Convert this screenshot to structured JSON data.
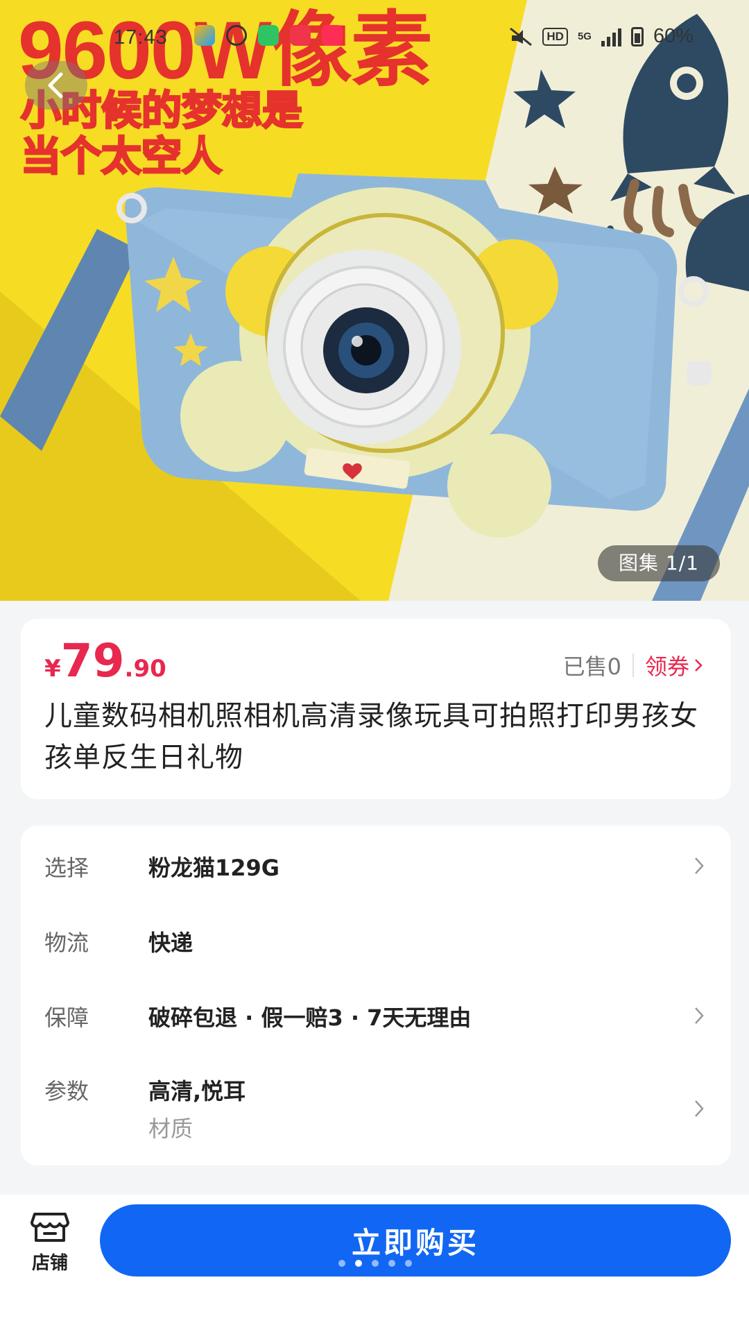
{
  "status_bar": {
    "time": "17:43",
    "hd": "HD",
    "network": "5G",
    "battery": "60%"
  },
  "hero": {
    "headline": "9600W像素",
    "tagline_line1": "小时候的梦想是",
    "tagline_line2": "当个太空人",
    "gallery_counter": "图集 1/1",
    "image_subject": "blue kids camera on yellow background with rocket and stars"
  },
  "product": {
    "currency": "¥",
    "price_integer": "79",
    "price_decimal": ".90",
    "sold": "已售0",
    "coupon": "领券",
    "title": "儿童数码相机照相机高清录像玩具可拍照打印男孩女孩单反生日礼物"
  },
  "specs": [
    {
      "label": "选择",
      "value": "粉龙猫129G"
    },
    {
      "label": "物流",
      "value": "快递"
    },
    {
      "label": "保障",
      "value": "破碎包退 · 假一赔3 · 7天无理由"
    },
    {
      "label": "参数",
      "value": "高清,悦耳",
      "sub": "材质"
    }
  ],
  "bottom_bar": {
    "store_label": "店铺",
    "buy_label": "立即购买"
  },
  "colors": {
    "price_red": "#e8284f",
    "buy_blue": "#1167f3",
    "hero_yellow": "#f6dc2a"
  },
  "icons": [
    "back-arrow-icon",
    "store-icon",
    "chevron-right-icon"
  ]
}
